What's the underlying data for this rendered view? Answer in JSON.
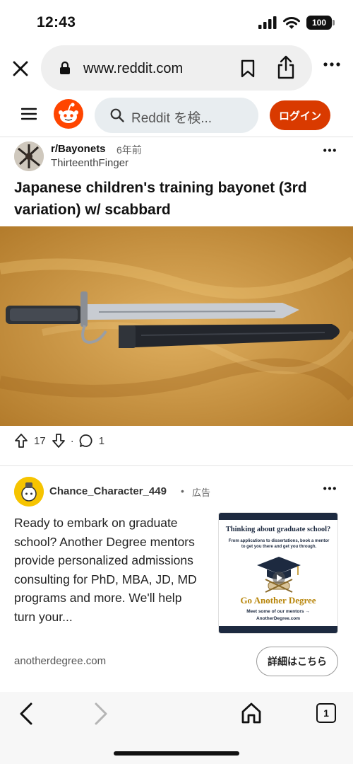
{
  "status_bar": {
    "time": "12:43",
    "battery": "100"
  },
  "browser": {
    "url": "www.reddit.com",
    "tabs_count": "1"
  },
  "reddit_header": {
    "search_placeholder": "Reddit を検...",
    "login_label": "ログイン"
  },
  "post": {
    "subreddit": "r/Bayonets",
    "time": "6年前",
    "user": "ThirteenthFinger",
    "title": "Japanese children's training bayonet (3rd variation) w/ scabbard",
    "upvotes": "17",
    "comments": "1"
  },
  "ad": {
    "user": "Chance_Character_449",
    "separator": "•",
    "tag": "広告",
    "body": "Ready to embark on graduate school? Another Degree mentors provide personalized admissions consulting for PhD, MBA, JD, MD programs and more. We'll help turn your...",
    "card": {
      "headline": "Thinking about graduate school?",
      "sub": "From applications to dissertations, book a mentor to get you there and get you through.",
      "brand": "Go Another Degree",
      "meet": "Meet some of our mentors →",
      "url": "AnotherDegree.com"
    },
    "domain": "anotherdegree.com",
    "cta_label": "詳細はこちら"
  },
  "colors": {
    "reddit_orange": "#ff4500",
    "login_bg": "#d93a00",
    "image_bg": "#c9903d",
    "card_navy": "#1d2a40",
    "card_gold": "#b8860b"
  }
}
